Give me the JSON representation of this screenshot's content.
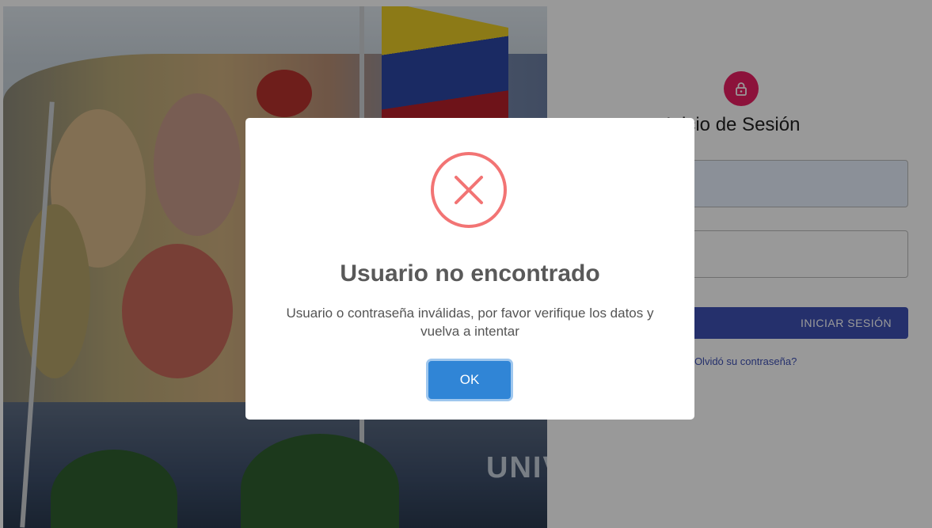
{
  "login": {
    "icon": "lock-icon",
    "title": "Inicio de Sesión",
    "submit_label": "INICIAR SESIÓN",
    "forgot_link": "¿Olvidó su contraseña?",
    "accent_color": "#e91e63",
    "button_color": "#3f51b5"
  },
  "background": {
    "building_sign": "UNIV"
  },
  "modal": {
    "icon": "error-x-icon",
    "title": "Usuario no encontrado",
    "message": "Usuario o contraseña inválidas, por favor verifique los datos y vuelva a intentar",
    "ok_label": "OK",
    "icon_color": "#f27474",
    "ok_color": "#3085d6"
  }
}
